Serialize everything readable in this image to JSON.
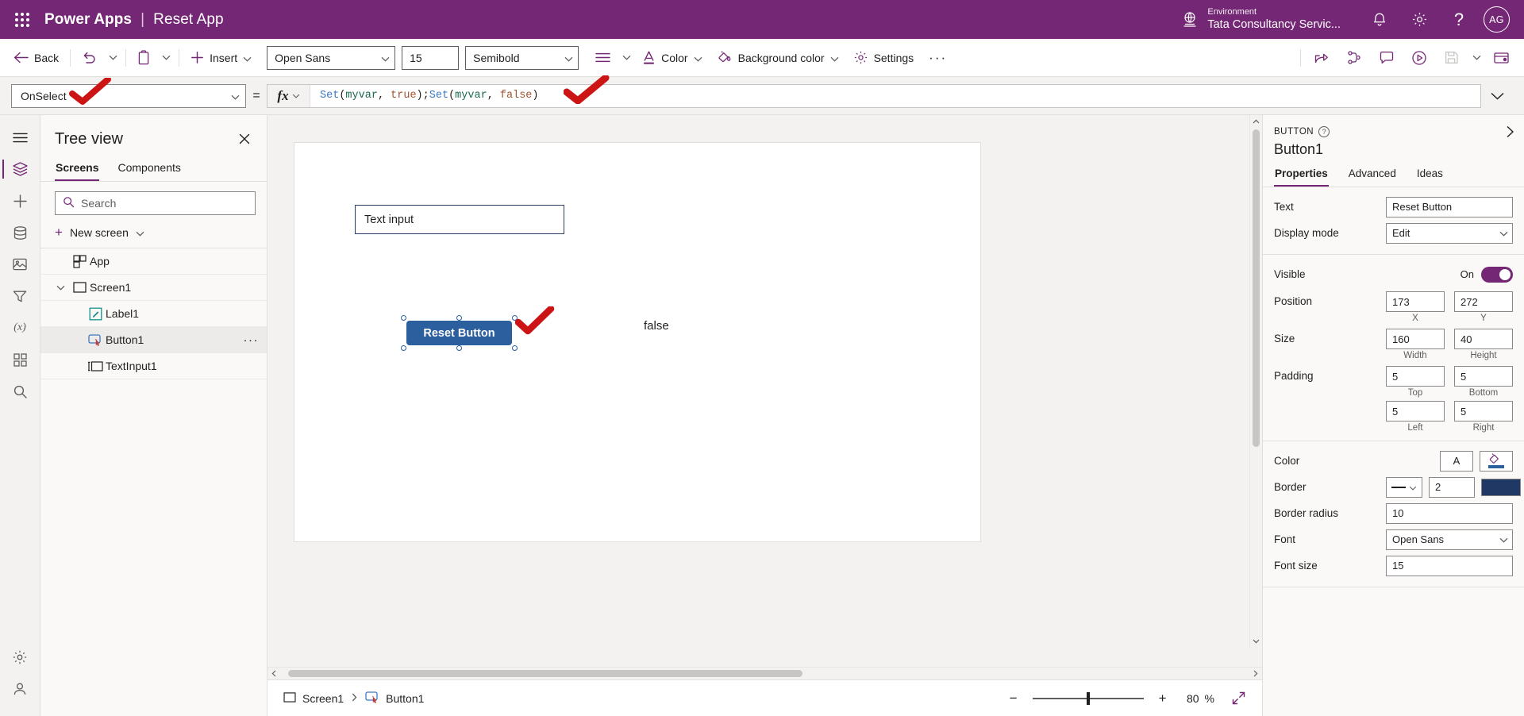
{
  "header": {
    "brand": "Power Apps",
    "separator": "|",
    "app_name": "Reset App",
    "environment_label": "Environment",
    "environment_name": "Tata Consultancy Servic...",
    "avatar_initials": "AG",
    "accent_color": "#742774"
  },
  "toolbar": {
    "back": "Back",
    "insert": "Insert",
    "font_family": "Open Sans",
    "font_size": "15",
    "font_weight": "Semibold",
    "color": "Color",
    "background_color": "Background color",
    "settings": "Settings",
    "overflow": "···"
  },
  "formula_bar": {
    "property": "OnSelect",
    "equals": "=",
    "fx": "fx",
    "formula_full": "Set(myvar, true);Set(myvar, false)",
    "tokens": [
      {
        "t": "Set",
        "k": "fn"
      },
      {
        "t": "(",
        "k": "pun"
      },
      {
        "t": "myvar",
        "k": "var"
      },
      {
        "t": ", ",
        "k": "pun"
      },
      {
        "t": "true",
        "k": "bool"
      },
      {
        "t": ");",
        "k": "pun"
      },
      {
        "t": "Set",
        "k": "fn"
      },
      {
        "t": "(",
        "k": "pun"
      },
      {
        "t": "myvar",
        "k": "var"
      },
      {
        "t": ", ",
        "k": "pun"
      },
      {
        "t": "false",
        "k": "bool"
      },
      {
        "t": ")",
        "k": "pun"
      }
    ]
  },
  "tree_view": {
    "title": "Tree view",
    "tabs": [
      {
        "label": "Screens",
        "active": true
      },
      {
        "label": "Components",
        "active": false
      }
    ],
    "search_placeholder": "Search",
    "search_value": "",
    "new_screen": "New screen",
    "items": [
      {
        "label": "App",
        "icon": "app-icon",
        "indent": 0,
        "caret": false,
        "selected": false
      },
      {
        "label": "Screen1",
        "icon": "screen-icon",
        "indent": 1,
        "caret": true,
        "selected": false
      },
      {
        "label": "Label1",
        "icon": "label-icon",
        "indent": 2,
        "caret": false,
        "selected": false
      },
      {
        "label": "Button1",
        "icon": "button-icon",
        "indent": 2,
        "caret": false,
        "selected": true
      },
      {
        "label": "TextInput1",
        "icon": "textinput-icon",
        "indent": 2,
        "caret": false,
        "selected": false
      }
    ]
  },
  "canvas": {
    "text_input_value": "Text input",
    "button_label": "Reset Button",
    "variable_output": "false"
  },
  "status_bar": {
    "screen_crumb": "Screen1",
    "control_crumb": "Button1",
    "zoom_value": "80",
    "zoom_unit": "%"
  },
  "properties": {
    "control_kind": "BUTTON",
    "control_name": "Button1",
    "tabs": [
      {
        "label": "Properties",
        "active": true
      },
      {
        "label": "Advanced",
        "active": false
      },
      {
        "label": "Ideas",
        "active": false
      }
    ],
    "rows": {
      "text_label": "Text",
      "text_value": "Reset Button",
      "display_mode_label": "Display mode",
      "display_mode_value": "Edit",
      "visible_label": "Visible",
      "visible_state": "On",
      "position_label": "Position",
      "position_x": "173",
      "position_y": "272",
      "position_x_sub": "X",
      "position_y_sub": "Y",
      "size_label": "Size",
      "size_width": "160",
      "size_height": "40",
      "size_width_sub": "Width",
      "size_height_sub": "Height",
      "padding_label": "Padding",
      "padding_top": "5",
      "padding_bottom": "5",
      "padding_left": "5",
      "padding_right": "5",
      "padding_top_sub": "Top",
      "padding_bottom_sub": "Bottom",
      "padding_left_sub": "Left",
      "padding_right_sub": "Right",
      "color_label": "Color",
      "color_text_glyph": "A",
      "border_label": "Border",
      "border_width": "2",
      "border_color": "#1f3864",
      "border_radius_label": "Border radius",
      "border_radius_value": "10",
      "font_label": "Font",
      "font_value": "Open Sans",
      "font_size_label": "Font size",
      "font_size_value": "15"
    }
  }
}
